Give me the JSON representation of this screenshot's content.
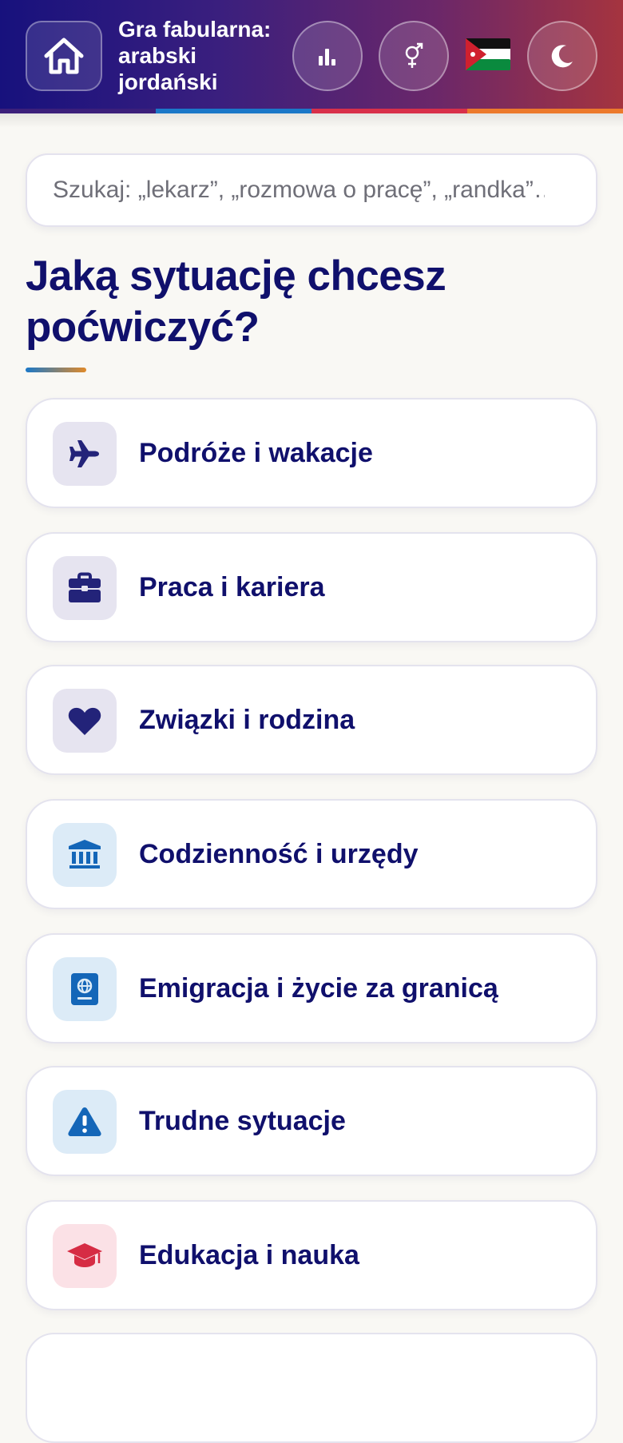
{
  "header": {
    "title": "Gra fabularna: arabski jordański",
    "stripe_colors": [
      "#3b1f7a",
      "#1b78c8",
      "#d8304a",
      "#ec7a2c"
    ],
    "buttons": {
      "home": "home-icon",
      "stats": "bar-chart-icon",
      "gender": "gender-icon",
      "language_flag": "jordan-flag-icon",
      "theme": "moon-icon"
    }
  },
  "search": {
    "placeholder": "Szukaj: „lekarz”, „rozmowa o pracę”, „randka”…"
  },
  "main": {
    "title": "Jaką sytuację chcesz poćwiczyć?",
    "categories": [
      {
        "label": "Podróże i wakacje",
        "icon": "airplane-icon",
        "icon_bg": "#e6e4f0",
        "icon_color": "#232379"
      },
      {
        "label": "Praca i kariera",
        "icon": "briefcase-icon",
        "icon_bg": "#e6e4f0",
        "icon_color": "#232379"
      },
      {
        "label": "Związki i rodzina",
        "icon": "heart-icon",
        "icon_bg": "#e6e4f0",
        "icon_color": "#232379"
      },
      {
        "label": "Codzienność i urzędy",
        "icon": "institution-icon",
        "icon_bg": "#dcebf7",
        "icon_color": "#1466b8"
      },
      {
        "label": "Emigracja i życie za granicą",
        "icon": "passport-icon",
        "icon_bg": "#dcebf7",
        "icon_color": "#1466b8"
      },
      {
        "label": "Trudne sytuacje",
        "icon": "warning-icon",
        "icon_bg": "#dcebf7",
        "icon_color": "#1466b8"
      },
      {
        "label": "Edukacja i nauka",
        "icon": "graduation-cap-icon",
        "icon_bg": "#fbe1e6",
        "icon_color": "#d62c44"
      }
    ]
  },
  "colors": {
    "primary_text": "#10106c",
    "page_background": "#f9f8f4"
  }
}
